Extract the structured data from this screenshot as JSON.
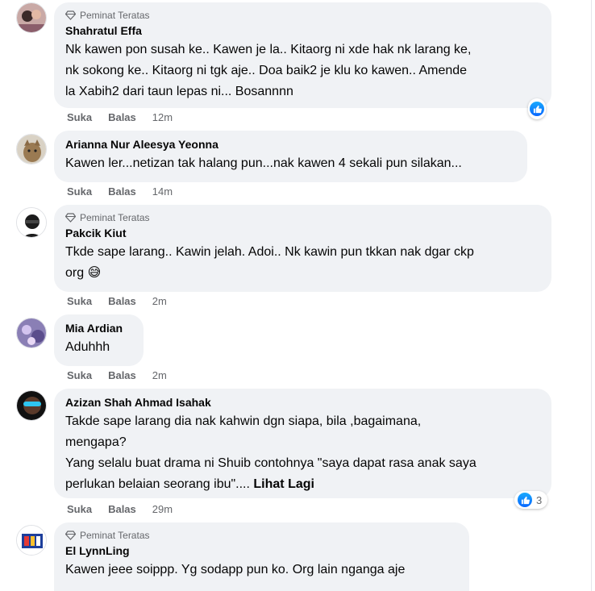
{
  "labels": {
    "top_fan": "Peminat Teratas",
    "like": "Suka",
    "reply": "Balas"
  },
  "colors": {
    "bubble_bg": "#f0f2f5",
    "meta_text": "#65676b",
    "like_blue": "#0866ff"
  },
  "comments": [
    {
      "badge": true,
      "author": "Shahratul Effa",
      "lines": [
        "Nk kawen pon susah ke.. Kawen je la.. Kitaorg ni xde hak nk larang ke,",
        "nk sokong ke.. Kitaorg ni tgk aje.. Doa baik2 je klu ko kawen.. Amende",
        "la Xabih2 dari taun lepas ni... Bosannnn"
      ],
      "time": "12m",
      "reaction": {
        "icon": "like-icon",
        "count": ""
      }
    },
    {
      "badge": false,
      "author": "Arianna Nur Aleesya Yeonna",
      "lines": [
        "Kawen ler...netizan tak halang pun...nak kawen 4 sekali pun silakan..."
      ],
      "time": "14m"
    },
    {
      "badge": true,
      "author": "Pakcik Kiut",
      "lines": [
        "Tkde sape larang.. Kawin jelah. Adoi.. Nk kawin pun tkkan nak dgar ckp",
        "org 😅"
      ],
      "time": "2m"
    },
    {
      "badge": false,
      "author": "Mia Ardian",
      "lines": [
        "Aduhhh"
      ],
      "time": "2m"
    },
    {
      "badge": false,
      "author": "Azizan Shah Ahmad Isahak",
      "lines": [
        "Takde sape larang dia nak kahwin dgn siapa, bila ,bagaimana,",
        "mengapa?",
        "Yang selalu buat drama ni Shuib contohnya \"saya dapat rasa anak saya",
        "perlukan belaian seorang ibu\"...."
      ],
      "see_more": "Lihat Lagi",
      "time": "29m",
      "reaction": {
        "icon": "like-icon",
        "count": "3"
      }
    },
    {
      "badge": true,
      "author": "El LynnLing",
      "lines": [
        "Kawen jeee soippp. Yg sodapp pun ko. Org lain nganga aje"
      ],
      "time": ""
    }
  ]
}
